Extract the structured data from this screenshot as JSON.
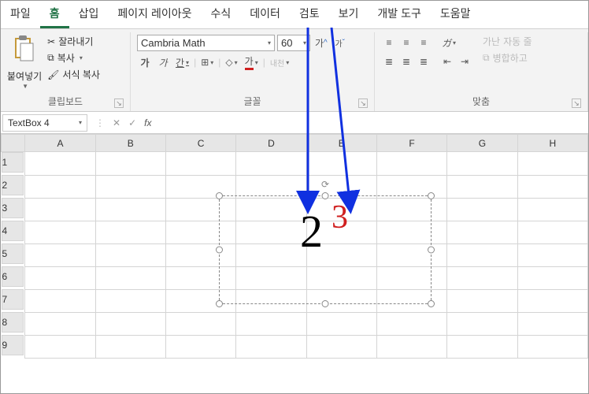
{
  "tabs": [
    "파일",
    "홈",
    "삽입",
    "페이지 레이아웃",
    "수식",
    "데이터",
    "검토",
    "보기",
    "개발 도구",
    "도움말"
  ],
  "activeTab": 1,
  "clipboard": {
    "paste": "붙여넣기",
    "cut": "잘라내기",
    "copy": "복사",
    "formatPainter": "서식 복사",
    "groupLabel": "클립보드"
  },
  "font": {
    "name": "Cambria Math",
    "size": "60",
    "growLabel": "가",
    "shrinkLabel": "가",
    "boldLabel": "가",
    "italicLabel": "가",
    "underlineLabel": "간",
    "fontColorLabel": "가",
    "groupLabel": "글꼴"
  },
  "alignment": {
    "wrapLabel": "자동 줄",
    "mergeLabel": "병합하고",
    "innerLabel": "내천",
    "groupLabel": "맞춤"
  },
  "nameBox": "TextBox 4",
  "columns": [
    "A",
    "B",
    "C",
    "D",
    "E",
    "F",
    "G",
    "H"
  ],
  "rows": [
    "1",
    "2",
    "3",
    "4",
    "5",
    "6",
    "7",
    "8",
    "9"
  ],
  "content": {
    "base": "2",
    "exp": "3"
  }
}
